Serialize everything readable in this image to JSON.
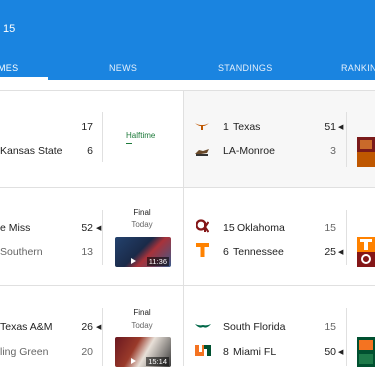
{
  "header": {
    "title": "15"
  },
  "tabs": [
    {
      "label": "GAMES",
      "visible_label": "MES"
    },
    {
      "label": "NEWS"
    },
    {
      "label": "STANDINGS"
    },
    {
      "label": "RANKIN"
    }
  ],
  "games": [
    {
      "left": {
        "team1": {
          "name": "",
          "score": "17"
        },
        "team2": {
          "name": "Kansas State",
          "score": "6"
        },
        "status": "Halftime"
      },
      "right": {
        "team1": {
          "rank": "1",
          "name": "Texas",
          "score": "51",
          "winner": true
        },
        "team2": {
          "rank": "",
          "name": "LA-Monroe",
          "score": "3"
        }
      }
    },
    {
      "left": {
        "team1": {
          "name": "e Miss",
          "score": "52",
          "winner": true
        },
        "team2": {
          "name": "Southern",
          "score": "13"
        },
        "status": "Final",
        "date": "Today",
        "video_duration": "11:36"
      },
      "right": {
        "team1": {
          "rank": "15",
          "name": "Oklahoma",
          "score": "15"
        },
        "team2": {
          "rank": "6",
          "name": "Tennessee",
          "score": "25",
          "winner": true
        }
      }
    },
    {
      "left": {
        "team1": {
          "name": "Texas A&M",
          "score": "26",
          "winner": true
        },
        "team2": {
          "name": "ling Green",
          "score": "20"
        },
        "status": "Final",
        "date": "Today",
        "video_duration": "15:14"
      },
      "right": {
        "team1": {
          "rank": "",
          "name": "South Florida",
          "score": "15"
        },
        "team2": {
          "rank": "8",
          "name": "Miami FL",
          "score": "50",
          "winner": true
        }
      }
    }
  ],
  "icons": {
    "texas": "longhorn-logo-icon",
    "monroe": "warhawks-logo-icon",
    "oklahoma": "oklahoma-logo-icon",
    "tennessee": "tennessee-logo-icon",
    "usf": "usf-bulls-logo-icon",
    "miami": "miami-u-logo-icon"
  },
  "colors": {
    "header_bg": "#1a84e0",
    "halftime": "#1d7a3a",
    "texas": "#bf5700",
    "oklahoma": "#841617",
    "tennessee": "#ff8200",
    "usf": "#006747",
    "miami_orange": "#f47321",
    "miami_green": "#005030"
  }
}
